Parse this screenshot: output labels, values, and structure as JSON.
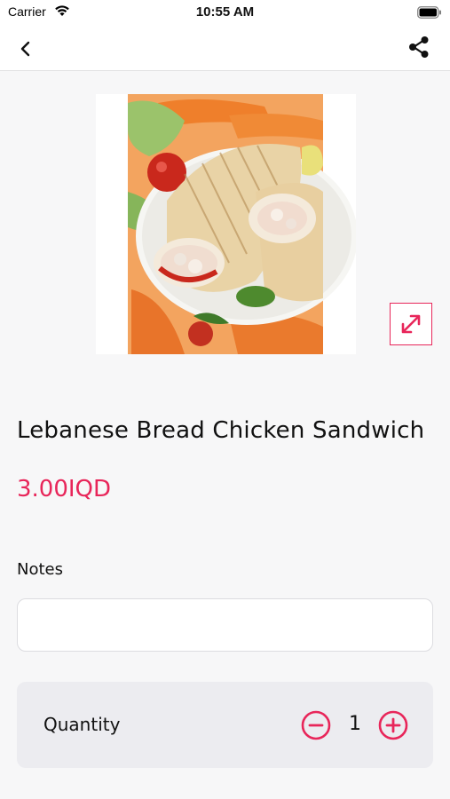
{
  "status_bar": {
    "carrier": "Carrier",
    "time": "10:55 AM",
    "icons": [
      "wifi-icon",
      "battery-icon"
    ]
  },
  "nav": {
    "back_icon": "chevron-left-icon",
    "share_icon": "share-icon"
  },
  "product": {
    "image_description": "Lebanese bread chicken wrap on a plate with tomatoes and lettuce",
    "expand_icon": "expand-diagonal-icon",
    "name": "Lebanese Bread Chicken Sandwich",
    "price": "3.00IQD"
  },
  "notes": {
    "label": "Notes",
    "value": "",
    "placeholder": ""
  },
  "quantity": {
    "label": "Quantity",
    "value": "1",
    "minus_icon": "minus-circle-icon",
    "plus_icon": "plus-circle-icon"
  },
  "colors": {
    "accent": "#e8265a",
    "background": "#f7f7f8",
    "card": "#ececf0"
  }
}
